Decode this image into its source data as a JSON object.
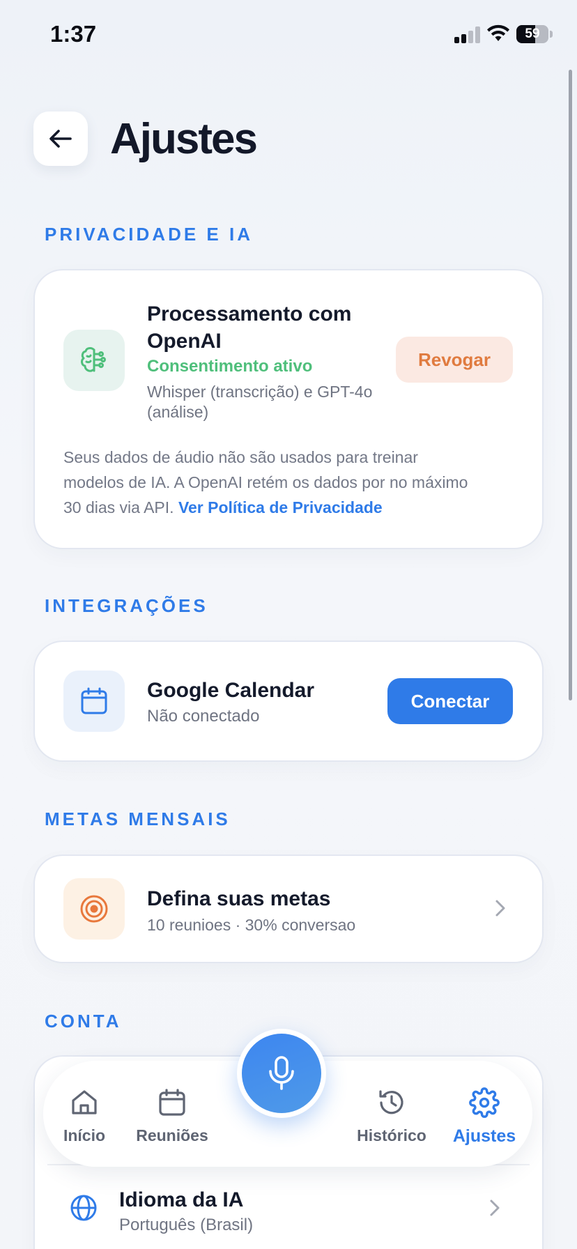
{
  "status_bar": {
    "time": "1:37",
    "battery": "59",
    "battery_level": 0.59
  },
  "header": {
    "back_icon": "arrow-left-icon",
    "title": "Ajustes"
  },
  "privacy": {
    "section_label": "PRIVACIDADE E IA",
    "icon": "brain-icon",
    "title_line1": "Processamento com",
    "title_line2": "OpenAI",
    "status": "Consentimento ativo",
    "status_color": "#4fbf7b",
    "models_line1": "Whisper (transcrição) e GPT-4o",
    "models_line2": "(análise)",
    "revoke_label": "Revogar",
    "revoke_color": "#e07b3f",
    "notice_line1": "Seus dados de áudio não são usados para treinar",
    "notice_line2": "modelos de IA. A OpenAI retém os dados por no máximo",
    "notice_line3": "30 dias via API.",
    "policy_link": "Ver Política de Privacidade"
  },
  "integrations": {
    "section_label": "INTEGRAÇÕES",
    "icon": "calendar-icon",
    "title": "Google Calendar",
    "status": "Não conectado",
    "connect_label": "Conectar",
    "connect_color": "#2f7be8"
  },
  "goals": {
    "section_label": "METAS MENSAIS",
    "icon": "target-icon",
    "title": "Defina suas metas",
    "subtitle": "10 reunioes · 30% conversao",
    "icon_color": "#e8783c"
  },
  "account": {
    "section_label": "CONTA",
    "language_icon": "globe-icon",
    "language_title": "Idioma da IA",
    "language_value": "Português (Brasil)"
  },
  "nav": {
    "items": [
      {
        "label": "Início",
        "icon": "home-icon"
      },
      {
        "label": "Reuniões",
        "icon": "calendar-icon"
      },
      {
        "label": "Histórico",
        "icon": "history-icon"
      },
      {
        "label": "Ajustes",
        "icon": "gear-icon"
      }
    ],
    "active": "Ajustes",
    "mic_icon": "microphone-icon",
    "accent": "#2f7be8"
  }
}
